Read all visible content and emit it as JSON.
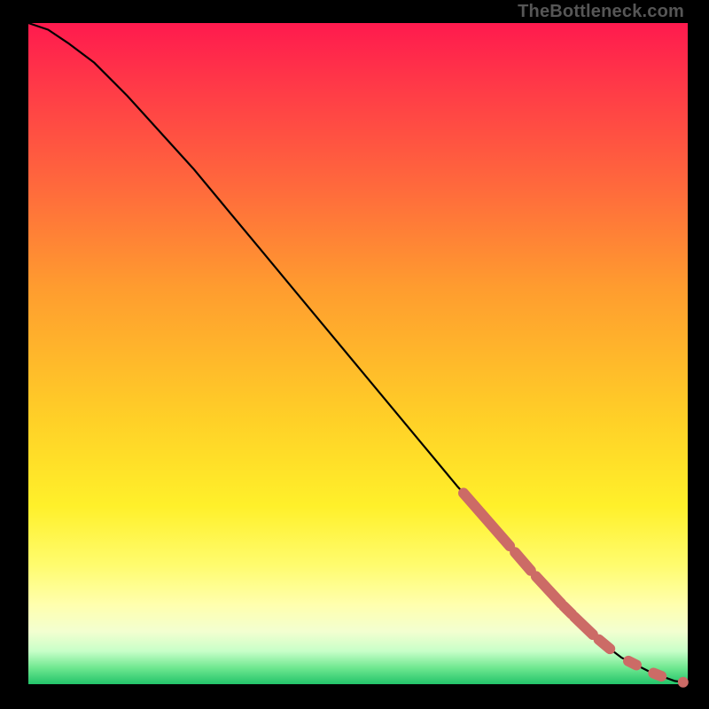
{
  "attribution": "TheBottleneck.com",
  "colors": {
    "background_frame": "#000000",
    "curve": "#000000",
    "marker": "#cc6b66",
    "gradient_stops": [
      "#ff1a4e",
      "#ff3b47",
      "#ff6a3c",
      "#ff9c2f",
      "#ffd027",
      "#fff02a",
      "#fffc6e",
      "#ffffae",
      "#f3ffd0",
      "#c8ffc8",
      "#70e890",
      "#23c46a"
    ]
  },
  "chart_data": {
    "type": "line",
    "title": "",
    "xlabel": "",
    "ylabel": "",
    "xlim": [
      0,
      100
    ],
    "ylim": [
      0,
      100
    ],
    "grid": false,
    "legend": false,
    "series": [
      {
        "name": "curve",
        "x": [
          0,
          3,
          6,
          10,
          15,
          20,
          25,
          30,
          35,
          40,
          45,
          50,
          55,
          60,
          65,
          70,
          75,
          80,
          85,
          88,
          90,
          92,
          94,
          96,
          98,
          100
        ],
        "y": [
          100,
          99,
          97,
          94,
          89,
          83.5,
          78,
          72,
          66,
          60,
          54,
          48,
          42,
          36,
          30,
          24.5,
          18.5,
          13,
          8,
          5.5,
          4,
          3,
          2,
          1.2,
          0.5,
          0.2
        ]
      }
    ],
    "markers": {
      "segments_x": [
        [
          66,
          73
        ],
        [
          73.8,
          76.2
        ],
        [
          77,
          80.8
        ],
        [
          81.2,
          82.4
        ],
        [
          82.8,
          85.6
        ],
        [
          86.5,
          88.2
        ],
        [
          91.0,
          92.2
        ],
        [
          94.8,
          96.0
        ]
      ],
      "dot_x": 99.3
    }
  }
}
